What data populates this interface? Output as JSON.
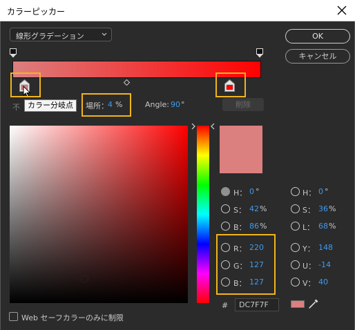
{
  "window": {
    "title": "カラーピッカー"
  },
  "gradient_type": {
    "selected": "線形グラデーション"
  },
  "buttons": {
    "ok": "OK",
    "cancel": "キャンセル",
    "delete": "削除"
  },
  "stop": {
    "tooltip": "カラー分岐点",
    "obscured_label": "不",
    "location_label": "場所：",
    "location_value": "4",
    "location_unit": "%",
    "angle_label": "Angle:",
    "angle_value": "90",
    "angle_unit": "°"
  },
  "colors": {
    "current": "#dc7f7f",
    "start_stop": "#dc7f7f",
    "end_stop": "#ff0000",
    "highlight": "#f2b51c",
    "value_blue": "#3d9bf0"
  },
  "fields_left": [
    {
      "label": "H：",
      "value": "0",
      "unit": "°",
      "selected": true
    },
    {
      "label": "S：",
      "value": "42",
      "unit": "%",
      "selected": false
    },
    {
      "label": "B：",
      "value": "86",
      "unit": "%",
      "selected": false
    },
    {
      "label": "R：",
      "value": "220",
      "unit": "",
      "selected": false
    },
    {
      "label": "G：",
      "value": "127",
      "unit": "",
      "selected": false
    },
    {
      "label": "B：",
      "value": "127",
      "unit": "",
      "selected": false
    }
  ],
  "fields_right": [
    {
      "label": "H：",
      "value": "0",
      "unit": "°",
      "selected": false
    },
    {
      "label": "S：",
      "value": "36",
      "unit": "%",
      "selected": false
    },
    {
      "label": "L：",
      "value": "68",
      "unit": "%",
      "selected": false
    },
    {
      "label": "Y：",
      "value": "148",
      "unit": "",
      "selected": false
    },
    {
      "label": "U：",
      "value": "-14",
      "unit": "",
      "selected": false
    },
    {
      "label": "V：",
      "value": "40",
      "unit": "",
      "selected": false
    }
  ],
  "hex": {
    "hash": "#",
    "value": "DC7F7F"
  },
  "web_safe": {
    "label": "Web セーフカラーのみに制限",
    "checked": false
  },
  "icons": {
    "close": "close-icon",
    "dropdown": "chevron-down-icon",
    "eyedropper": "eyedropper-icon",
    "cursor": "mouse-pointer-icon"
  }
}
